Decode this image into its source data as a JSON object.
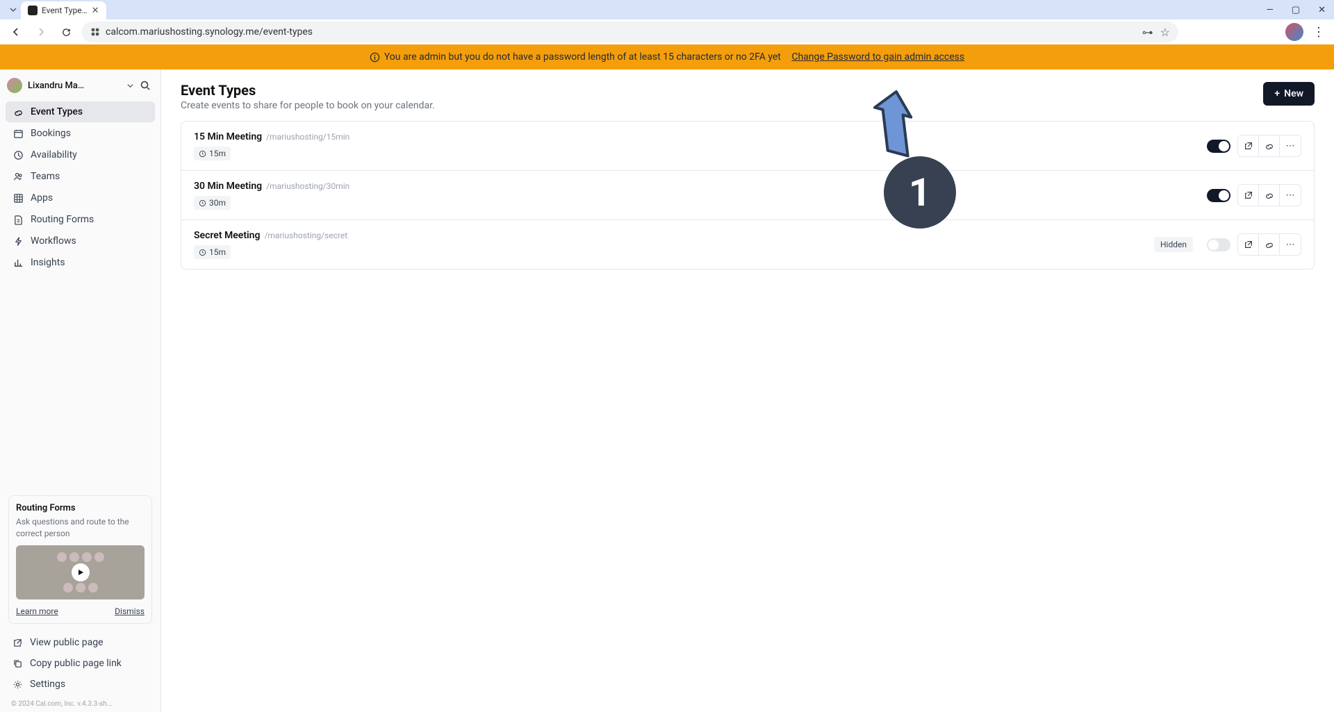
{
  "browser": {
    "tab_title": "Event Type…",
    "url": "calcom.mariushosting.synology.me/event-types"
  },
  "banner": {
    "message": "You are admin but you do not have a password length of at least 15 characters or no 2FA yet",
    "link_text": "Change Password to gain admin access"
  },
  "sidebar": {
    "user_name": "Lixandru Ma…",
    "nav": [
      {
        "label": "Event Types",
        "active": true
      },
      {
        "label": "Bookings"
      },
      {
        "label": "Availability"
      },
      {
        "label": "Teams"
      },
      {
        "label": "Apps"
      },
      {
        "label": "Routing Forms"
      },
      {
        "label": "Workflows"
      },
      {
        "label": "Insights"
      }
    ],
    "promo": {
      "title": "Routing Forms",
      "desc": "Ask questions and route to the correct person",
      "learn": "Learn more",
      "dismiss": "Dismiss"
    },
    "bottom": [
      {
        "label": "View public page"
      },
      {
        "label": "Copy public page link"
      },
      {
        "label": "Settings"
      }
    ],
    "copyright": "© 2024 Cal.com, Inc. v.4.3.3-sh..."
  },
  "main": {
    "title": "Event Types",
    "subtitle": "Create events to share for people to book on your calendar.",
    "new_label": "New",
    "events": [
      {
        "title": "15 Min Meeting",
        "slug": "/mariushosting/15min",
        "duration": "15m",
        "enabled": true,
        "hidden": false
      },
      {
        "title": "30 Min Meeting",
        "slug": "/mariushosting/30min",
        "duration": "30m",
        "enabled": true,
        "hidden": false
      },
      {
        "title": "Secret Meeting",
        "slug": "/mariushosting/secret",
        "duration": "15m",
        "enabled": false,
        "hidden": true
      }
    ],
    "hidden_label": "Hidden"
  },
  "annotation": {
    "number": "1"
  }
}
